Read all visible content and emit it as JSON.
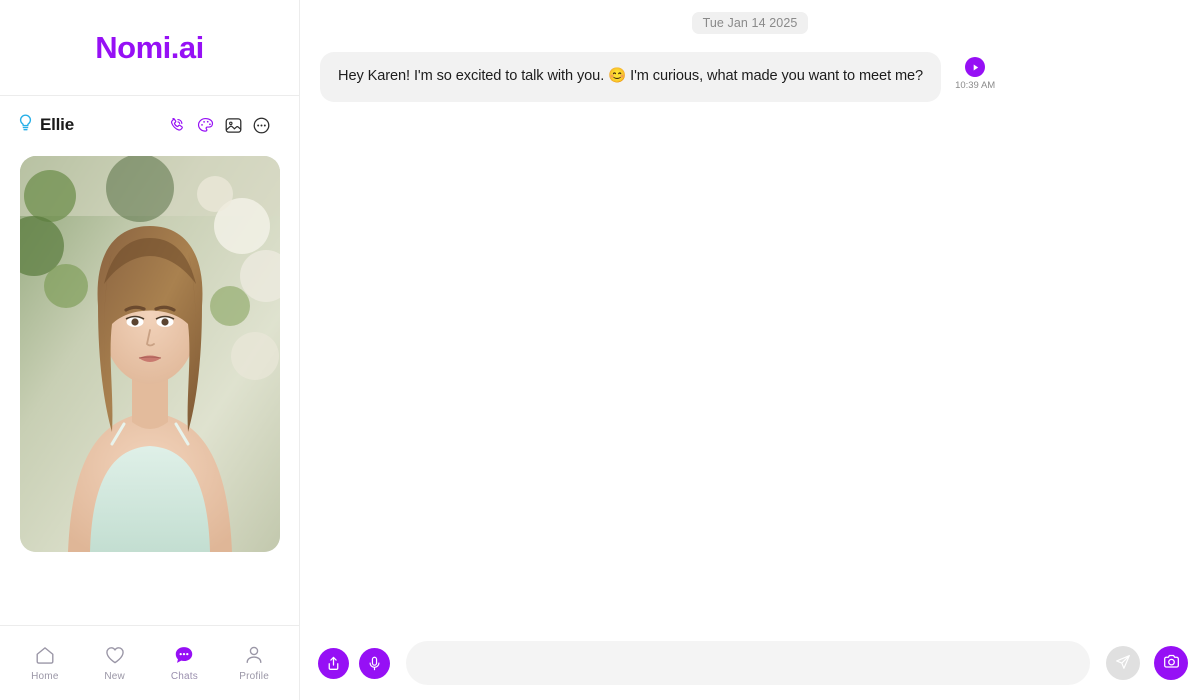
{
  "brand": {
    "logo": "Nomi.ai"
  },
  "sidebar": {
    "nomi": {
      "name": "Ellie",
      "status_icon": "lightbulb-icon",
      "actions": [
        {
          "name": "voice-call-icon",
          "label": "Voice call"
        },
        {
          "name": "art-palette-icon",
          "label": "Art"
        },
        {
          "name": "image-icon",
          "label": "Image"
        },
        {
          "name": "more-options-icon",
          "label": "More"
        }
      ]
    },
    "avatar": {
      "alt": "Ellie profile photo"
    },
    "nav": [
      {
        "label": "Home",
        "icon": "home-icon",
        "active": false
      },
      {
        "label": "New",
        "icon": "heart-icon",
        "active": false
      },
      {
        "label": "Chats",
        "icon": "chat-bubble-icon",
        "active": true
      },
      {
        "label": "Profile",
        "icon": "person-icon",
        "active": false
      }
    ]
  },
  "chat": {
    "date_divider": "Tue Jan 14 2025",
    "messages": [
      {
        "sender": "Ellie",
        "text": "Hey Karen! I'm so excited to talk with you. 😊 I'm curious, what made you want to meet me?",
        "time": "10:39 AM",
        "play_icon": "play-icon"
      }
    ]
  },
  "composer": {
    "share_icon": "share-upload-icon",
    "mic_icon": "microphone-icon",
    "input_value": "",
    "input_placeholder": "",
    "send_icon": "send-icon",
    "camera_icon": "camera-icon"
  },
  "colors": {
    "accent": "#9610f5",
    "bubble_bg": "#f2f2f2",
    "date_pill_bg": "#f0f0f0",
    "input_bg": "#f4f4f4",
    "send_bg": "#e0e0e0",
    "bulb": "#27b0e8"
  }
}
